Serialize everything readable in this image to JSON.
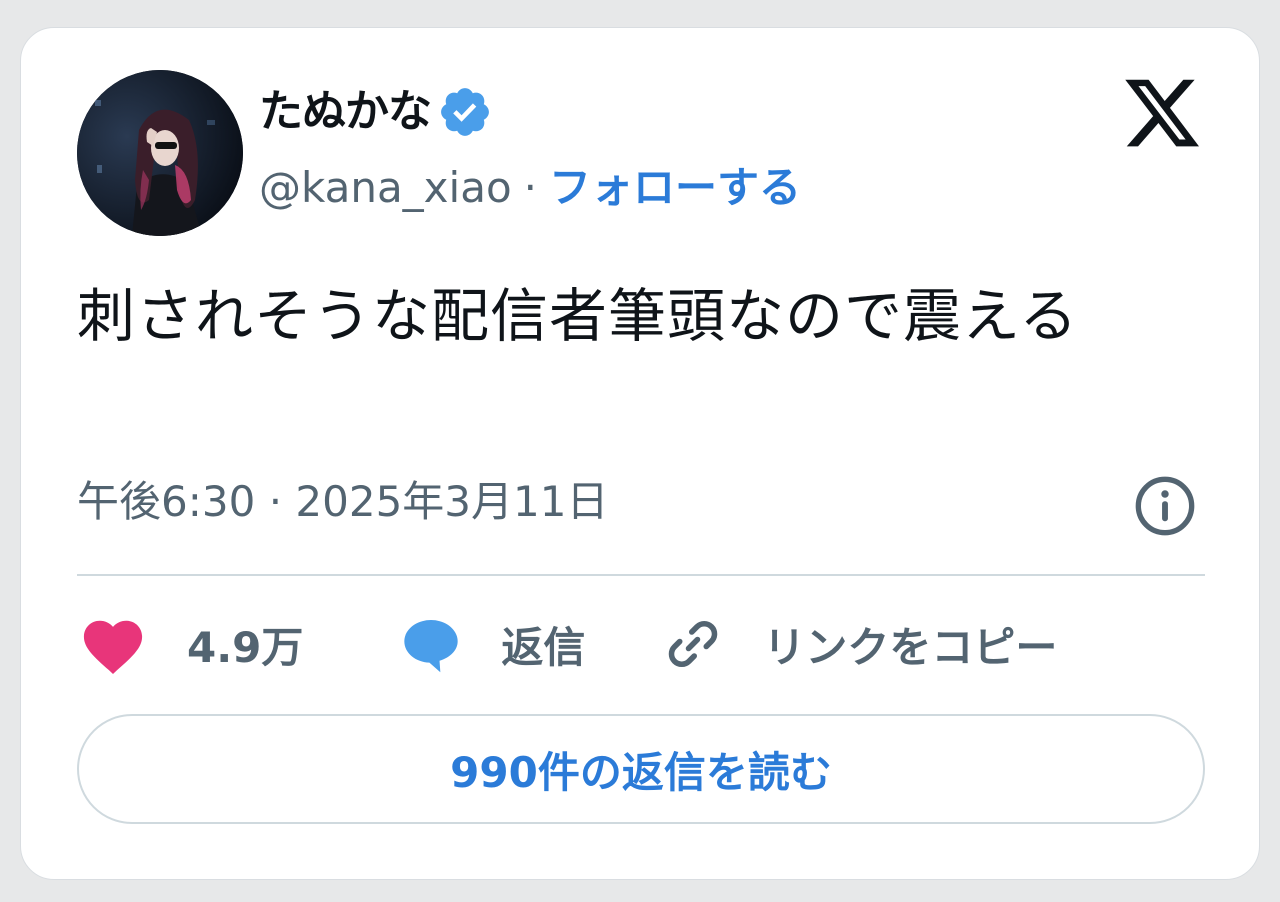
{
  "author": {
    "display_name": "たぬかな",
    "handle": "@kana_xiao",
    "separator": "·",
    "follow_label": "フォローする"
  },
  "tweet": {
    "text": "刺されそうな配信者筆頭なので震える",
    "time": "午後6:30",
    "date": "2025年3月11日",
    "meta_separator": "·"
  },
  "actions": {
    "like_count": "4.9万",
    "reply_label": "返信",
    "copy_link_label": "リンクをコピー"
  },
  "read_replies_label": "990件の返信を読む",
  "colors": {
    "accent": "#2b7bd8",
    "like": "#e8357a",
    "reply": "#4a9eea",
    "secondary_text": "#536471",
    "primary_text": "#0f1419"
  },
  "icons": {
    "verified": "verified-badge-icon",
    "logo": "x-logo-icon",
    "info": "info-icon",
    "like": "heart-icon",
    "reply": "speech-bubble-icon",
    "copy": "link-icon"
  }
}
